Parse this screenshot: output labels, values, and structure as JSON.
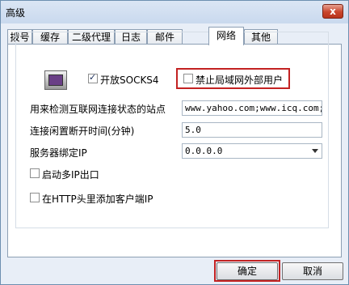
{
  "window": {
    "title": "高级",
    "close_symbol": "x"
  },
  "tabs": [
    "拨号",
    "缓存",
    "二级代理",
    "日志",
    "邮件",
    "网络",
    "其他"
  ],
  "active_tab": "网络",
  "network": {
    "enable_socks4": {
      "label": "开放SOCKS4",
      "checked": true
    },
    "block_lan": {
      "label": "禁止局域网外部用户",
      "checked": false
    },
    "detect_sites": {
      "label": "用来检测互联网连接状态的站点",
      "value": "www.yahoo.com;www.icq.com;www"
    },
    "idle_timeout": {
      "label": "连接闲置断开时间(分钟)",
      "value": "5.0"
    },
    "bind_ip": {
      "label": "服务器绑定IP",
      "value": "0.0.0.0"
    },
    "multi_ip_exit": {
      "label": "启动多IP出口",
      "checked": false
    },
    "http_header_ip": {
      "label": "在HTTP头里添加客户端IP",
      "checked": false
    }
  },
  "buttons": {
    "ok": "确定",
    "cancel": "取消"
  },
  "colors": {
    "highlight": "#c32222"
  }
}
